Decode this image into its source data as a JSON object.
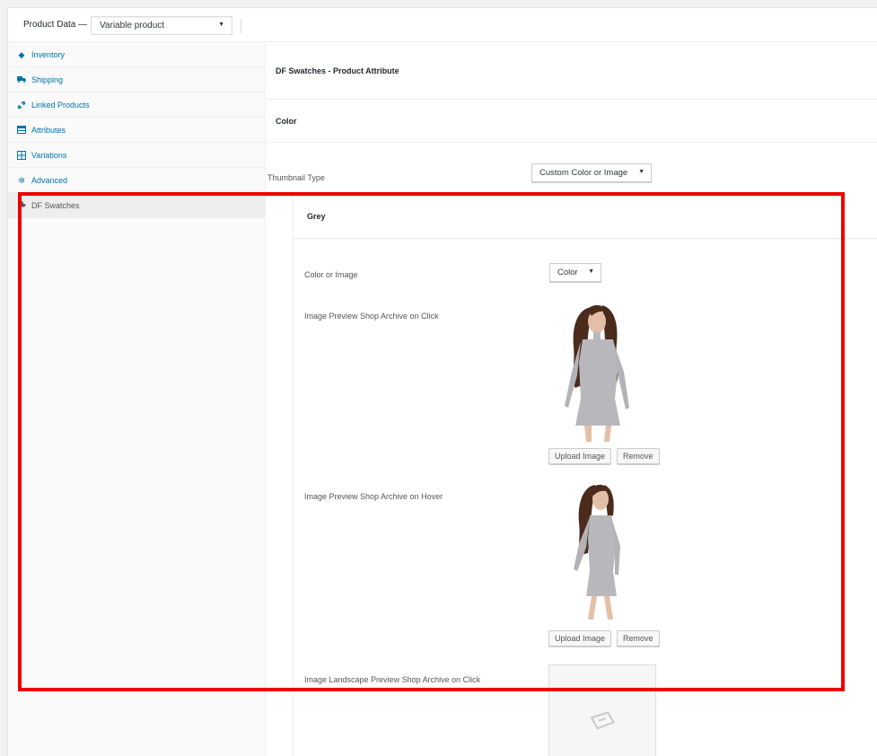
{
  "header": {
    "label": "Product Data —",
    "product_type": "Variable product"
  },
  "sidebar": {
    "items": [
      {
        "label": "Inventory",
        "icon": "diamond-icon"
      },
      {
        "label": "Shipping",
        "icon": "truck-icon"
      },
      {
        "label": "Linked Products",
        "icon": "link-icon"
      },
      {
        "label": "Attributes",
        "icon": "table-icon"
      },
      {
        "label": "Variations",
        "icon": "grid-icon"
      },
      {
        "label": "Advanced",
        "icon": "gear-icon"
      },
      {
        "label": "DF Swatches",
        "icon": "wrench-icon"
      }
    ],
    "active": "DF Swatches"
  },
  "main": {
    "section_title": "DF Swatches - Product Attribute",
    "attribute_title": "Color",
    "thumbnail_type_label": "Thumbnail Type",
    "thumbnail_type_value": "Custom Color or Image",
    "term_title": "Grey",
    "color_or_image_label": "Color or Image",
    "color_or_image_value": "Color",
    "preview_click_label": "Image Preview Shop Archive on Click",
    "preview_hover_label": "Image Preview Shop Archive on Hover",
    "landscape_click_label": "Image Landscape Preview Shop Archive on Click",
    "upload_label": "Upload Image",
    "remove_label": "Remove"
  },
  "colors": {
    "link": "#0073aa",
    "highlight": "#ee0000",
    "dress": "#b8b8bc",
    "hair": "#4a2b1c"
  }
}
